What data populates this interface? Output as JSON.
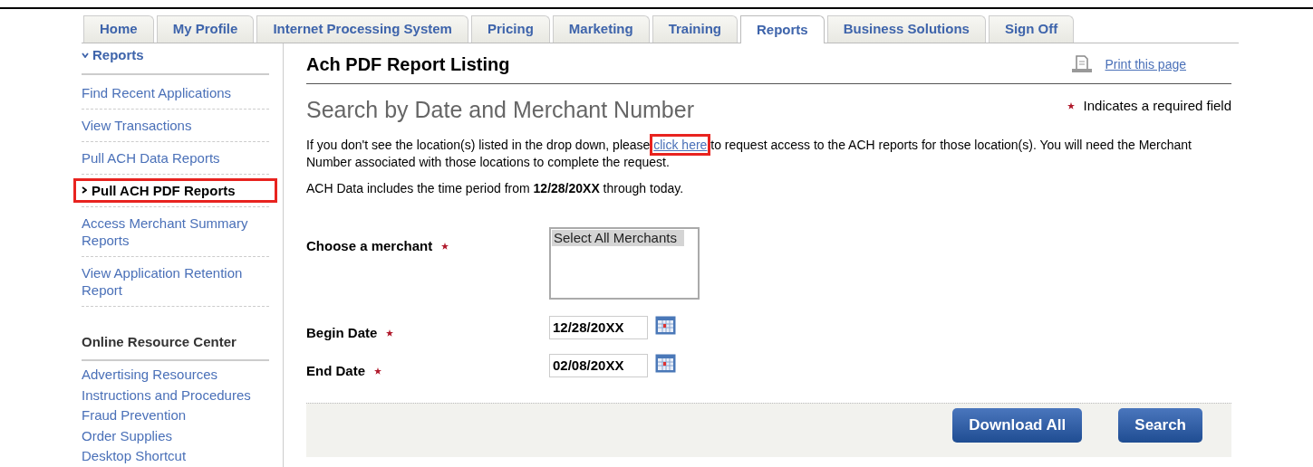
{
  "tabs": [
    {
      "label": "Home",
      "selected": false
    },
    {
      "label": "My Profile",
      "selected": false
    },
    {
      "label": "Internet Processing System",
      "selected": false
    },
    {
      "label": "Pricing",
      "selected": false
    },
    {
      "label": "Marketing",
      "selected": false
    },
    {
      "label": "Training",
      "selected": false
    },
    {
      "label": "Reports",
      "selected": true
    },
    {
      "label": "Business Solutions",
      "selected": false
    },
    {
      "label": "Sign Off",
      "selected": false
    }
  ],
  "sidebar": {
    "section": {
      "title": "Reports",
      "expanded": true
    },
    "items": [
      {
        "label": "Find Recent Applications",
        "selected": false,
        "highlighted": false
      },
      {
        "label": "View Transactions",
        "selected": false,
        "highlighted": false
      },
      {
        "label": "Pull ACH Data Reports",
        "selected": false,
        "highlighted": false
      },
      {
        "label": "Pull ACH PDF Reports",
        "selected": true,
        "highlighted": true
      },
      {
        "label": "Access Merchant Summary Reports",
        "selected": false,
        "highlighted": false
      },
      {
        "label": "View Application Retention Report",
        "selected": false,
        "highlighted": false
      }
    ],
    "resource_center": {
      "title": "Online Resource Center",
      "links": [
        "Advertising Resources",
        "Instructions and Procedures",
        "Fraud Prevention",
        "Order Supplies",
        "Desktop Shortcut"
      ]
    }
  },
  "main": {
    "title": "Ach PDF Report Listing",
    "print_link": "Print this page",
    "subtitle": "Search by Date and Merchant Number",
    "required_note": "Indicates a required field",
    "intro": {
      "before": "If you don't see the location(s) listed in the drop down, please ",
      "link": "click here",
      "link_highlighted": true,
      "after": " to request access to the ACH reports for those location(s). You will need the Merchant Number associated with those locations to complete the request."
    },
    "data_note": "ACH Data includes the time period from **12/28/20XX** through today.",
    "fields": [
      {
        "kind": "listbox",
        "label": "Choose a merchant",
        "required": true,
        "options": [
          {
            "label": "Select All Merchants",
            "selected": true
          }
        ]
      },
      {
        "kind": "date",
        "label": "Begin Date",
        "required": true,
        "value": "12/28/20XX"
      },
      {
        "kind": "date",
        "label": "End Date",
        "required": true,
        "value": "02/08/20XX"
      }
    ],
    "buttons": [
      "Download All",
      "Search"
    ]
  }
}
